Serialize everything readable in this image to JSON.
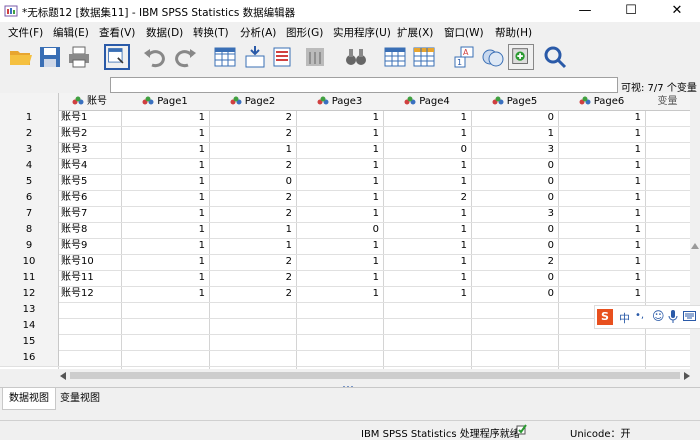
{
  "titlebar": {
    "title": "*无标题12 [数据集11] - IBM SPSS Statistics 数据编辑器",
    "min": "—",
    "max": "☐",
    "close": "✕"
  },
  "menubar": {
    "items": [
      "文件(F)",
      "编辑(E)",
      "查看(V)",
      "数据(D)",
      "转换(T)",
      "分析(A)",
      "图形(G)",
      "实用程序(U)",
      "扩展(X)",
      "窗口(W)",
      "帮助(H)"
    ]
  },
  "cellbar": {
    "visible": "可视: 7/7 个变量"
  },
  "grid": {
    "columns": [
      "账号",
      "Page1",
      "Page2",
      "Page3",
      "Page4",
      "Page5",
      "Page6",
      "变量"
    ],
    "rows": [
      {
        "n": "1",
        "v": [
          "账号1",
          "1",
          "2",
          "1",
          "1",
          "0",
          "1"
        ]
      },
      {
        "n": "2",
        "v": [
          "账号2",
          "1",
          "2",
          "1",
          "1",
          "1",
          "1"
        ]
      },
      {
        "n": "3",
        "v": [
          "账号3",
          "1",
          "1",
          "1",
          "0",
          "3",
          "1"
        ]
      },
      {
        "n": "4",
        "v": [
          "账号4",
          "1",
          "2",
          "1",
          "1",
          "0",
          "1"
        ]
      },
      {
        "n": "5",
        "v": [
          "账号5",
          "1",
          "0",
          "1",
          "1",
          "0",
          "1"
        ]
      },
      {
        "n": "6",
        "v": [
          "账号6",
          "1",
          "2",
          "1",
          "2",
          "0",
          "1"
        ]
      },
      {
        "n": "7",
        "v": [
          "账号7",
          "1",
          "2",
          "1",
          "1",
          "3",
          "1"
        ]
      },
      {
        "n": "8",
        "v": [
          "账号8",
          "1",
          "1",
          "0",
          "1",
          "0",
          "1"
        ]
      },
      {
        "n": "9",
        "v": [
          "账号9",
          "1",
          "1",
          "1",
          "1",
          "0",
          "1"
        ]
      },
      {
        "n": "10",
        "v": [
          "账号10",
          "1",
          "2",
          "1",
          "1",
          "2",
          "1"
        ]
      },
      {
        "n": "11",
        "v": [
          "账号11",
          "1",
          "2",
          "1",
          "1",
          "0",
          "1"
        ]
      },
      {
        "n": "12",
        "v": [
          "账号12",
          "1",
          "2",
          "1",
          "1",
          "0",
          "1"
        ]
      },
      {
        "n": "13",
        "v": [
          "",
          "",
          "",
          "",
          "",
          "",
          ""
        ]
      },
      {
        "n": "14",
        "v": [
          "",
          "",
          "",
          "",
          "",
          "",
          ""
        ]
      },
      {
        "n": "15",
        "v": [
          "",
          "",
          "",
          "",
          "",
          "",
          ""
        ]
      },
      {
        "n": "16",
        "v": [
          "",
          "",
          "",
          "",
          "",
          "",
          ""
        ]
      }
    ]
  },
  "tabs": {
    "data_view": "数据视图",
    "variable_view": "变量视图"
  },
  "status": {
    "processor": "IBM SPSS Statistics 处理程序就绪",
    "unicode": "Unicode：开"
  },
  "ime": {
    "zh": "中",
    "dot": "•,",
    "smile": "☺"
  }
}
